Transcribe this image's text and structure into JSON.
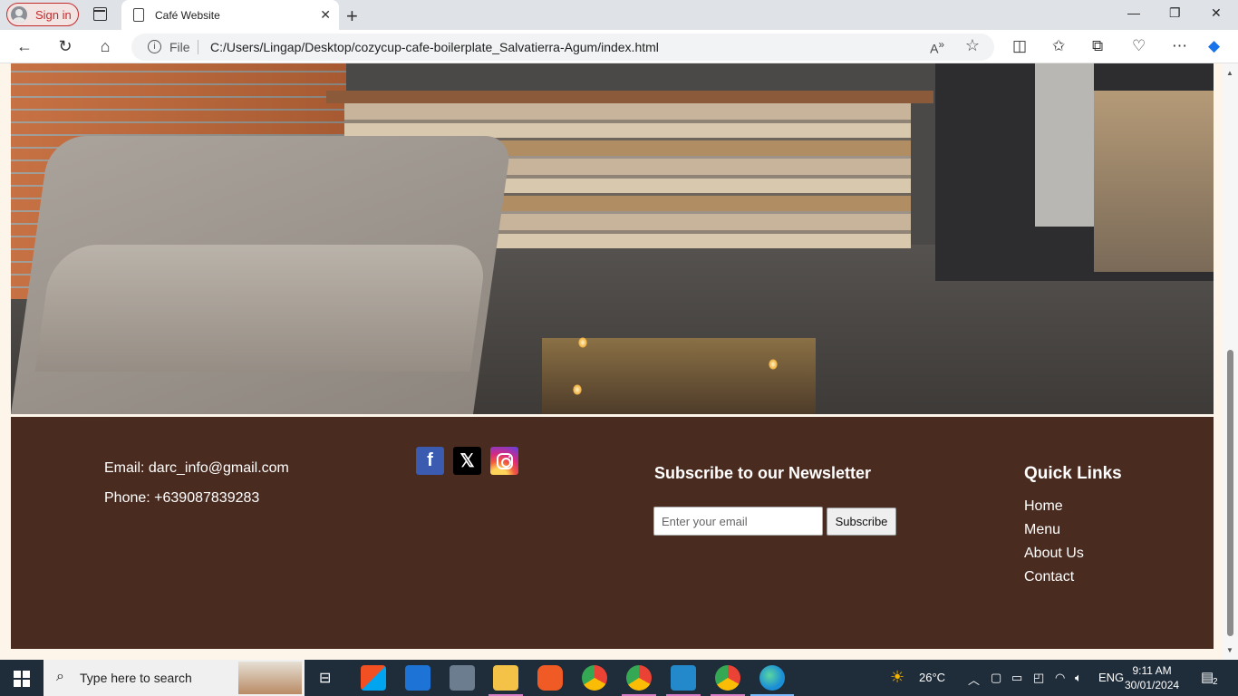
{
  "browser": {
    "sign_in": "Sign in",
    "tab_title": "Café Website",
    "file_label": "File",
    "url": "C:/Users/Lingap/Desktop/cozycup-cafe-boilerplate_Salvatierra-Agum/index.html"
  },
  "footer": {
    "email": "Email: darc_info@gmail.com",
    "phone": "Phone: +639087839283",
    "social": [
      "facebook-icon",
      "x-icon",
      "instagram-icon"
    ],
    "newsletter": {
      "title": "Subscribe to our Newsletter",
      "placeholder": "Enter your email",
      "button": "Subscribe"
    },
    "quick_links": {
      "title": "Quick Links",
      "items": [
        "Home",
        "Menu",
        "About Us",
        "Contact"
      ]
    },
    "background": "#4a2b20"
  },
  "taskbar": {
    "search_placeholder": "Type here to search",
    "weather": "26°C",
    "language": "ENG",
    "time": "9:11 AM",
    "date": "30/01/2024",
    "notifications": "2"
  }
}
